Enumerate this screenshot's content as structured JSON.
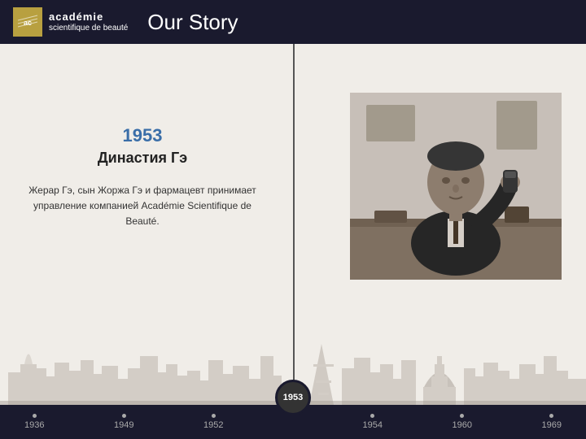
{
  "header": {
    "logo_brand": "académie",
    "logo_subtitle": "scientifique de beauté",
    "title": "Our Story"
  },
  "content": {
    "year": "1953",
    "dynasty_title": "Династия Гэ",
    "description": "Жерар Гэ, сын Жоржа Гэ и фармацевт принимает управление компанией Académie Scientifique de Beauté."
  },
  "timeline": {
    "years": [
      "1936",
      "1949",
      "1952",
      "1953",
      "1954",
      "1960",
      "1969"
    ],
    "active_year": "1953"
  }
}
